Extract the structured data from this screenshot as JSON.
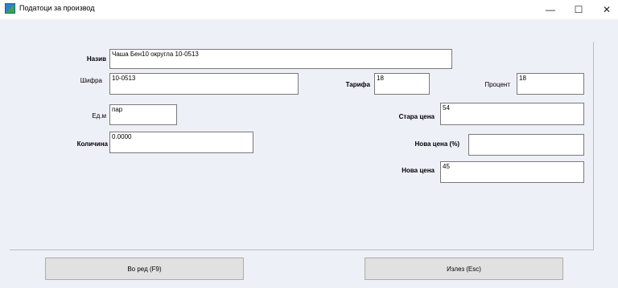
{
  "window": {
    "title": "Податоци за производ",
    "controls": {
      "minimize": "—",
      "maximize": "☐",
      "close": "✕"
    }
  },
  "form": {
    "naziv": {
      "label": "Назив",
      "value": "Чаша Бен10 округла 10-0513"
    },
    "shifra": {
      "label": "Шифра",
      "value": "10-0513"
    },
    "tarifa": {
      "label": "Тарифа",
      "value": "18"
    },
    "procent": {
      "label": "Процент",
      "value": "18"
    },
    "edm": {
      "label": "Ед.м",
      "value": "пар"
    },
    "stara_cena": {
      "label": "Стара цена",
      "value": "54"
    },
    "kolicina": {
      "label": "Количина",
      "value": "0.0000"
    },
    "nova_cena_pct": {
      "label": "Нова цена (%)",
      "value": ""
    },
    "nova_cena": {
      "label": "Нова цена",
      "value": "45"
    }
  },
  "buttons": {
    "ok": "Во ред (F9)",
    "exit": "Излез (Esc)"
  }
}
